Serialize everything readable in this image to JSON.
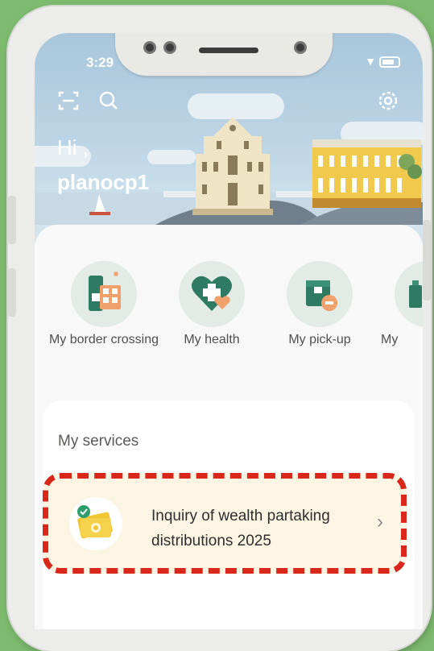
{
  "status_bar": {
    "time": "3:29"
  },
  "header": {
    "greeting": "Hi ,",
    "username": "planocp1"
  },
  "shortcuts": [
    {
      "label": "My border crossing",
      "icon": "border-crossing-icon"
    },
    {
      "label": "My health",
      "icon": "health-heart-icon"
    },
    {
      "label": "My pick-up",
      "icon": "pickup-box-icon"
    },
    {
      "label": "My",
      "icon": "more-service-icon"
    }
  ],
  "services": {
    "title": "My services",
    "items": [
      {
        "label": "Inquiry of wealth partaking distributions 2025",
        "icon": "wealth-money-icon"
      }
    ]
  },
  "colors": {
    "background": "#7dbb6f",
    "accent_green": "#2e7a63",
    "highlight_red": "#d9271c",
    "service_card": "#fdf5e3"
  }
}
